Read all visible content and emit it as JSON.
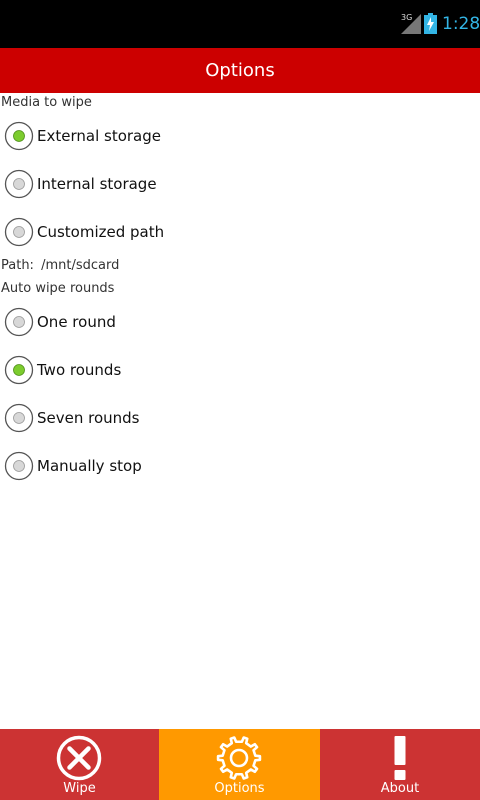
{
  "status_bar": {
    "network": "3G",
    "time": "1:28"
  },
  "title_bar": {
    "title": "Options"
  },
  "media_section": {
    "label": "Media to wipe",
    "options": [
      {
        "label": "External storage",
        "selected": true
      },
      {
        "label": "Internal storage",
        "selected": false
      },
      {
        "label": "Customized path",
        "selected": false
      }
    ],
    "path_label": "Path:",
    "path_value": "/mnt/sdcard"
  },
  "rounds_section": {
    "label": "Auto wipe rounds",
    "options": [
      {
        "label": "One round",
        "selected": false
      },
      {
        "label": "Two rounds",
        "selected": true
      },
      {
        "label": "Seven rounds",
        "selected": false
      },
      {
        "label": "Manually stop",
        "selected": false
      }
    ]
  },
  "tabs": [
    {
      "label": "Wipe",
      "icon": "close-circle-icon",
      "active": false
    },
    {
      "label": "Options",
      "icon": "gear-icon",
      "active": true
    },
    {
      "label": "About",
      "icon": "exclamation-icon",
      "active": false
    }
  ],
  "colors": {
    "title_bar": "#cc0000",
    "tab_inactive": "#cc3333",
    "tab_active": "#ff9900",
    "radio_selected": "#7ccc2e",
    "clock": "#33b5e5"
  }
}
